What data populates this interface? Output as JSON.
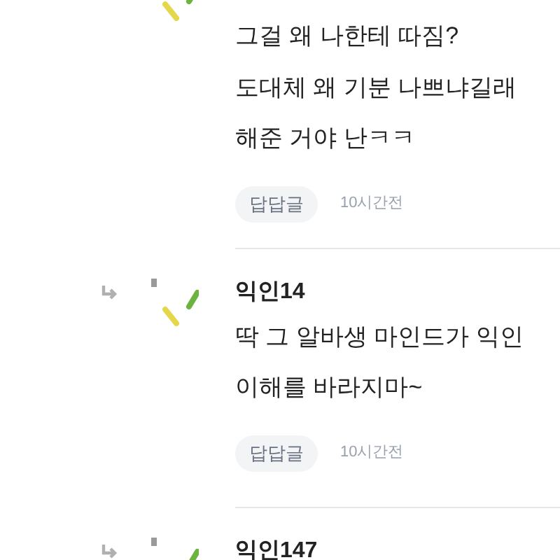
{
  "comments": [
    {
      "reply": false,
      "lines": [
        "그걸 왜 나한테 따짐?",
        "도대체 왜 기분 나쁘냐길래",
        "해준 거야 난ㅋㅋ"
      ],
      "reply_button": "답답글",
      "time": "10시간전"
    },
    {
      "reply": true,
      "name": "익인14",
      "lines": [
        "딱 그 알바생 마인드가 익인",
        "이해를 바라지마~"
      ],
      "reply_button": "답답글",
      "time": "10시간전"
    },
    {
      "reply": true,
      "name": "익인147"
    }
  ]
}
